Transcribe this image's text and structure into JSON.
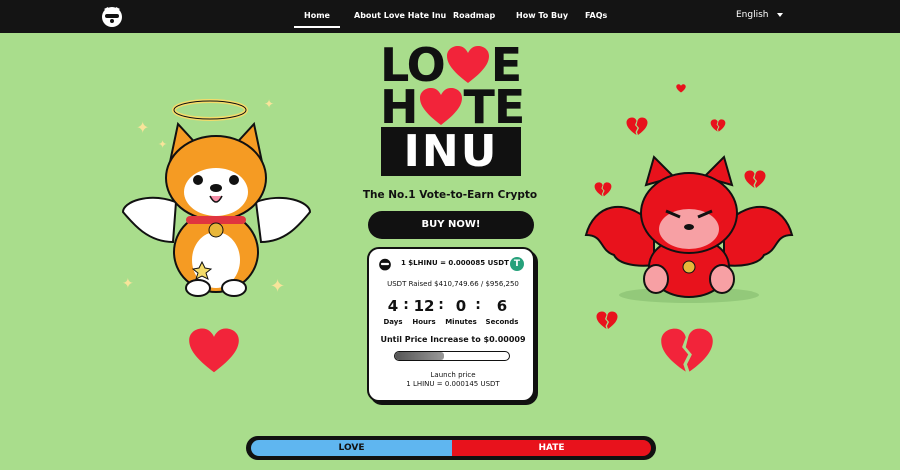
{
  "nav": {
    "links": [
      "Home",
      "About Love Hate Inu",
      "Roadmap",
      "How To Buy",
      "FAQs"
    ],
    "language": "English"
  },
  "brand": {
    "line1_left": "LO",
    "line1_right": "E",
    "line2_left": "H",
    "line2_right": "TE",
    "line3": "INU"
  },
  "hero": {
    "tagline": "The No.1 Vote-to-Earn Crypto",
    "buy_label": "BUY NOW!"
  },
  "presale": {
    "price_text": "1 $LHINU = 0.000085 USDT",
    "tether_symbol": "T",
    "raised_text": "USDT Raised $410,749.66 / $956,250",
    "countdown": [
      {
        "value": "4",
        "label": "Days"
      },
      {
        "value": "12",
        "label": "Hours"
      },
      {
        "value": "0",
        "label": "Minutes"
      },
      {
        "value": "6",
        "label": "Seconds"
      }
    ],
    "increase_text": "Until Price Increase to $0.00009",
    "progress": 0.43,
    "launch_label": "Launch price",
    "launch_value": "1 LHINU = 0.000145 USDT"
  },
  "vote": {
    "love_label": "LOVE",
    "hate_label": "HATE"
  },
  "colors": {
    "background": "#a9dd8c",
    "love": "#5fb6f0",
    "hate": "#e8121c",
    "heart": "#f2243a"
  }
}
